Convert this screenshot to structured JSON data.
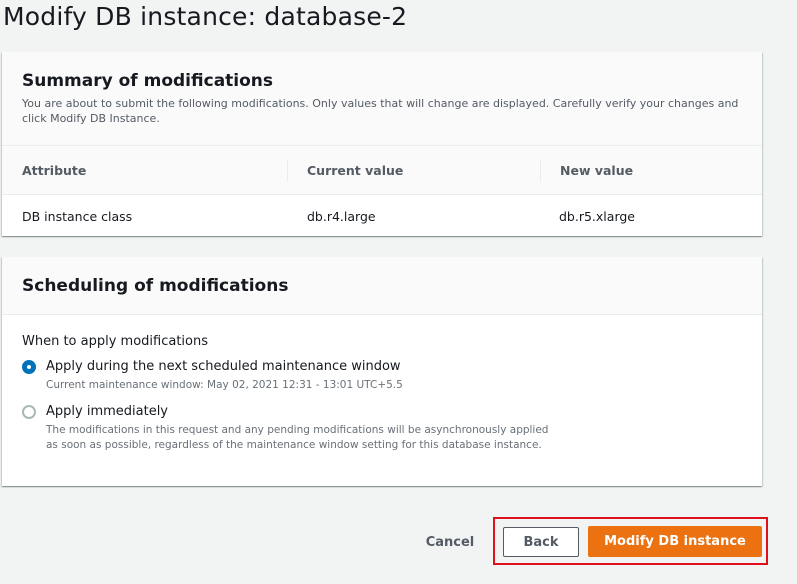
{
  "page": {
    "title": "Modify DB instance: database-2"
  },
  "summary": {
    "title": "Summary of modifications",
    "description": "You are about to submit the following modifications. Only values that will change are displayed. Carefully verify your changes and click Modify DB Instance.",
    "columns": [
      "Attribute",
      "Current value",
      "New value"
    ],
    "rows": [
      [
        "DB instance class",
        "db.r4.large",
        "db.r5.xlarge"
      ]
    ]
  },
  "scheduling": {
    "title": "Scheduling of modifications",
    "field_label": "When to apply modifications",
    "options": [
      {
        "label": "Apply during the next scheduled maintenance window",
        "description": "Current maintenance window: May 02, 2021 12:31 - 13:01 UTC+5.5",
        "selected": true
      },
      {
        "label": "Apply immediately",
        "description": "The modifications in this request and any pending modifications will be asynchronously applied as soon as possible, regardless of the maintenance window setting for this database instance.",
        "selected": false
      }
    ]
  },
  "actions": {
    "cancel": "Cancel",
    "back": "Back",
    "submit": "Modify DB instance"
  },
  "colors": {
    "primary": "#ec7211",
    "radio_selected": "#0073bb",
    "highlight": "#e0101c"
  }
}
